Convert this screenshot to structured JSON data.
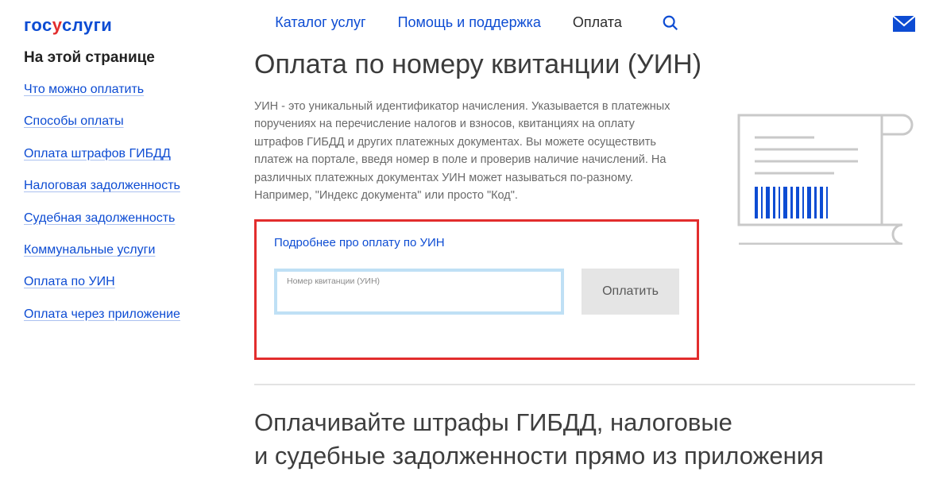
{
  "logo": {
    "part1": "гос",
    "part2": "у",
    "part3": "слуги"
  },
  "nav": {
    "catalog": "Каталог услуг",
    "help": "Помощь и поддержка",
    "payment": "Оплата"
  },
  "sidebar": {
    "title": "На этой странице",
    "links": [
      "Что можно оплатить",
      "Способы оплаты",
      "Оплата штрафов ГИБДД",
      "Налоговая задолженность",
      "Судебная задолженность",
      "Коммунальные услуги",
      "Оплата по УИН",
      "Оплата через приложение"
    ]
  },
  "main": {
    "title": "Оплата по номеру квитанции (УИН)",
    "description": "УИН - это уникальный идентификатор начисления. Указывается в платежных поручениях на перечисление налогов и взносов, квитанциях на оплату штрафов ГИБДД и других платежных документах. Вы можете осуществить платеж на портале, введя номер в поле и проверив наличие начислений. На различных платежных документах УИН может называться по-разному. Например, \"Индекс документа\" или просто \"Код\".",
    "more_link": "Подробнее про оплату по УИН",
    "input_label": "Номер квитанции (УИН)",
    "input_value": "",
    "pay_button": "Оплатить",
    "section2_title_line1": "Оплачивайте штрафы ГИБДД, налоговые",
    "section2_title_line2": "и судебные задолженности прямо из приложения"
  }
}
